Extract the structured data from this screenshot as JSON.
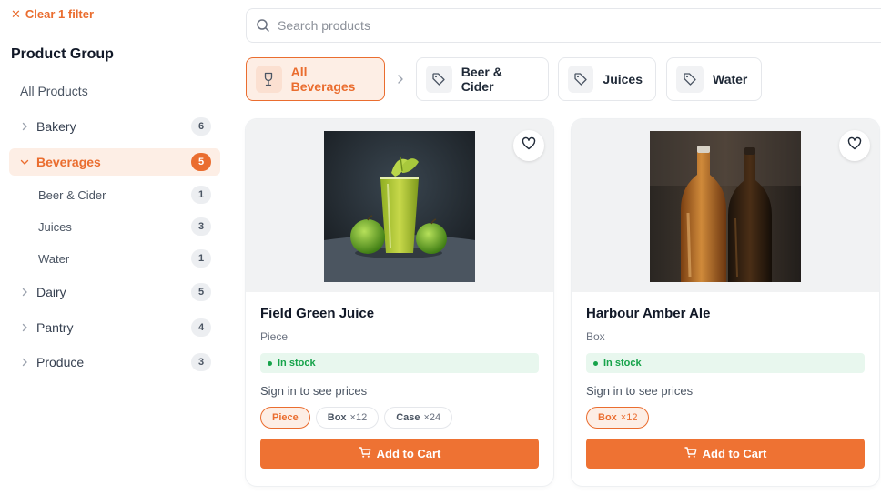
{
  "filters": {
    "clear_label": "Clear 1 filter"
  },
  "sidebar": {
    "title": "Product Group",
    "all_products": "All Products",
    "categories": [
      {
        "label": "Bakery",
        "count": "6"
      },
      {
        "label": "Beverages",
        "count": "5",
        "expanded": true,
        "active": true
      },
      {
        "label": "Dairy",
        "count": "5"
      },
      {
        "label": "Pantry",
        "count": "4"
      },
      {
        "label": "Produce",
        "count": "3"
      }
    ],
    "subcategories": [
      {
        "label": "Beer & Cider",
        "count": "1"
      },
      {
        "label": "Juices",
        "count": "3"
      },
      {
        "label": "Water",
        "count": "1"
      }
    ]
  },
  "search": {
    "placeholder": "Search products"
  },
  "chips": [
    {
      "label": "All Beverages",
      "icon": "glass-icon",
      "active": true
    },
    {
      "label": "Beer & Cider",
      "icon": "tag-icon"
    },
    {
      "label": "Juices",
      "icon": "tag-icon"
    },
    {
      "label": "Water",
      "icon": "tag-icon"
    }
  ],
  "products": [
    {
      "name": "Field Green Juice",
      "unit": "Piece",
      "stock": "In stock",
      "price_note": "Sign in to see prices",
      "options": [
        {
          "label": "Piece",
          "qty": "",
          "selected": true
        },
        {
          "label": "Box",
          "qty": "×12"
        },
        {
          "label": "Case",
          "qty": "×24"
        }
      ],
      "cta": "Add to Cart"
    },
    {
      "name": "Harbour Amber Ale",
      "unit": "Box",
      "stock": "In stock",
      "price_note": "Sign in to see prices",
      "options": [
        {
          "label": "Box",
          "qty": "×12",
          "selected": true
        }
      ],
      "cta": "Add to Cart"
    }
  ],
  "colors": {
    "accent": "#ea6d2f",
    "accent_bg": "#fdeee5",
    "stock_green": "#16a34a",
    "stock_bg": "#e8f7ee"
  }
}
